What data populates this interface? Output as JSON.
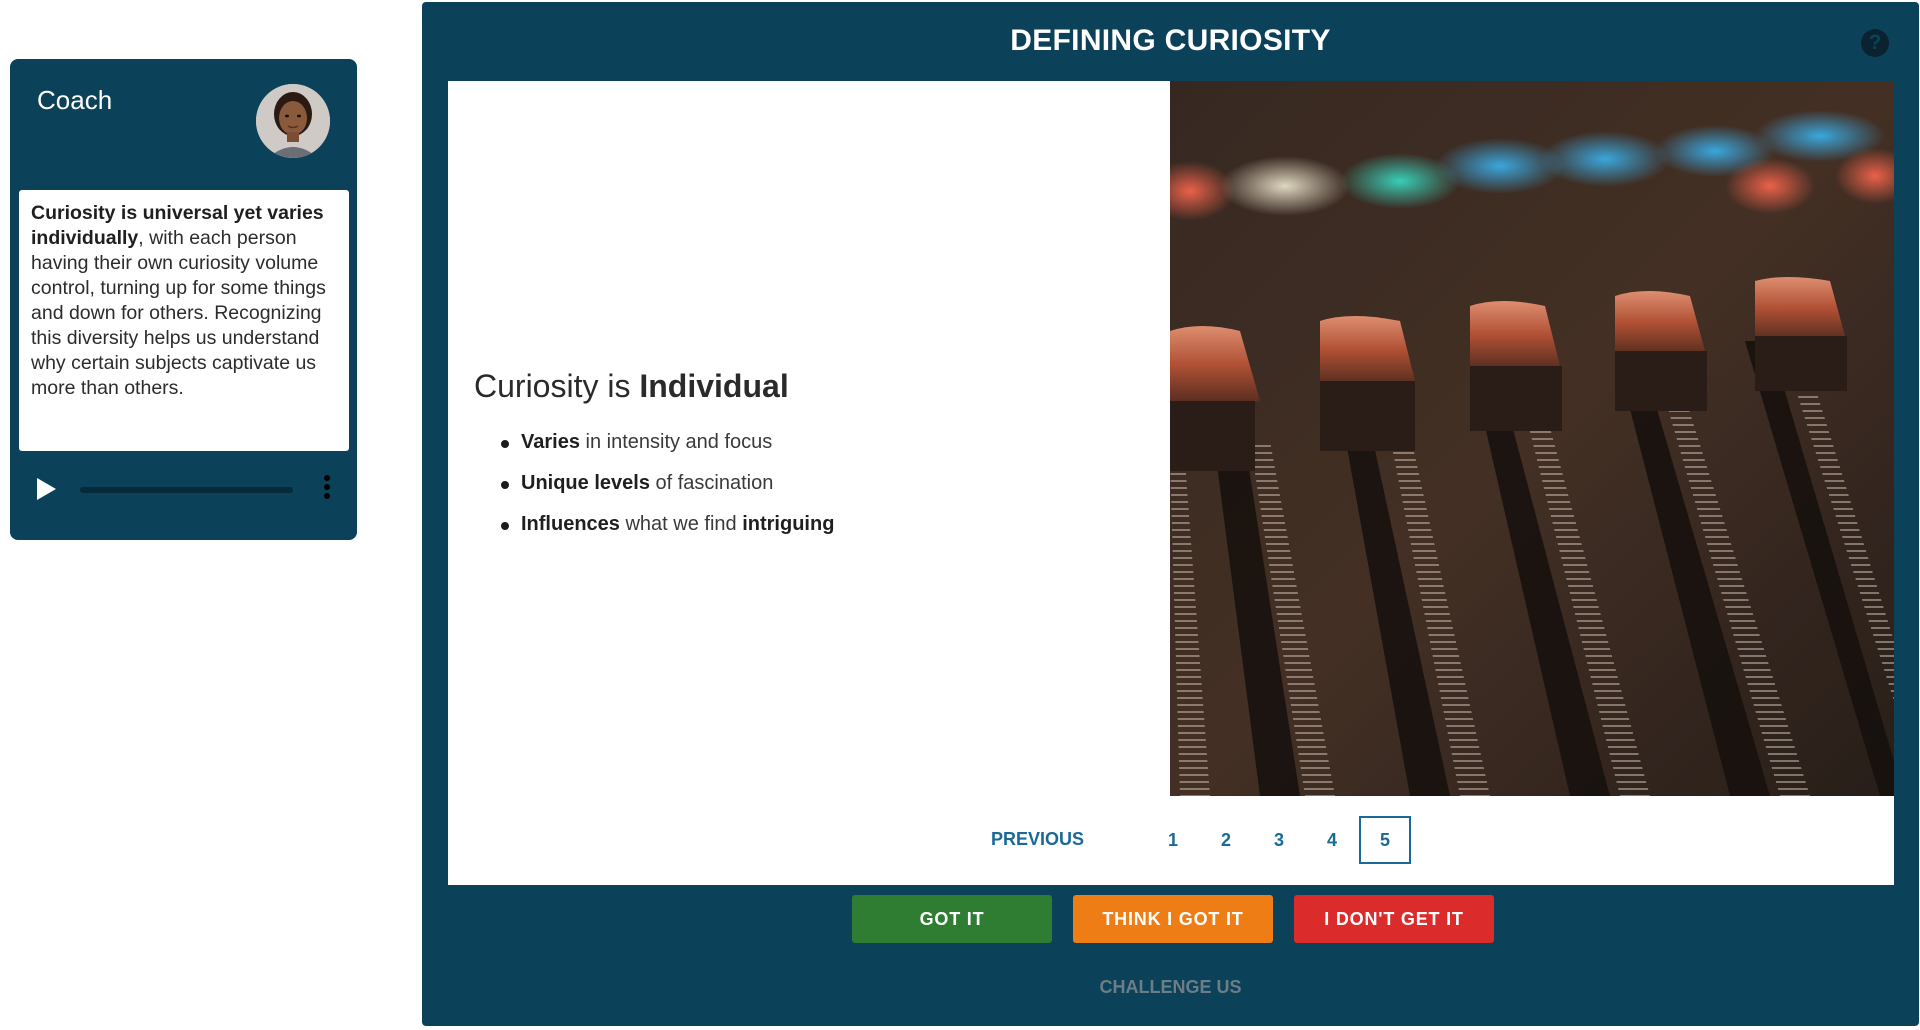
{
  "coach": {
    "title": "Coach",
    "message_bold": "Curiosity is universal yet varies individually",
    "message_rest": ", with each person having their own curiosity volume control, turning up for some things and down for others. Recognizing this diversity helps us understand why certain subjects captivate us more than others."
  },
  "header": {
    "title": "DEFINING CURIOSITY",
    "help_icon": "question-circle-icon"
  },
  "slide": {
    "heading_plain": "Curiosity is ",
    "heading_bold": "Individual",
    "bullets": [
      {
        "bold": "Varies",
        "text": " in intensity and focus"
      },
      {
        "bold": "Unique levels",
        "text": " of fascination"
      },
      {
        "bold": "Influences",
        "text": " what we find ",
        "bold2": "intriguing"
      }
    ],
    "image": "audio-mixer-faders-photo"
  },
  "pagination": {
    "previous_label": "PREVIOUS",
    "pages": [
      "1",
      "2",
      "3",
      "4",
      "5"
    ],
    "current_page": "5"
  },
  "actions": {
    "got_it": "GOT IT",
    "think_got_it": "THINK I GOT IT",
    "dont_get_it": "I DON'T GET IT",
    "challenge": "CHALLENGE US"
  },
  "colors": {
    "frame": "#0c4259",
    "got_it": "#2e7d32",
    "think_got_it": "#ef7d16",
    "dont_get_it": "#dc2b2b",
    "link": "#1a6a97"
  }
}
